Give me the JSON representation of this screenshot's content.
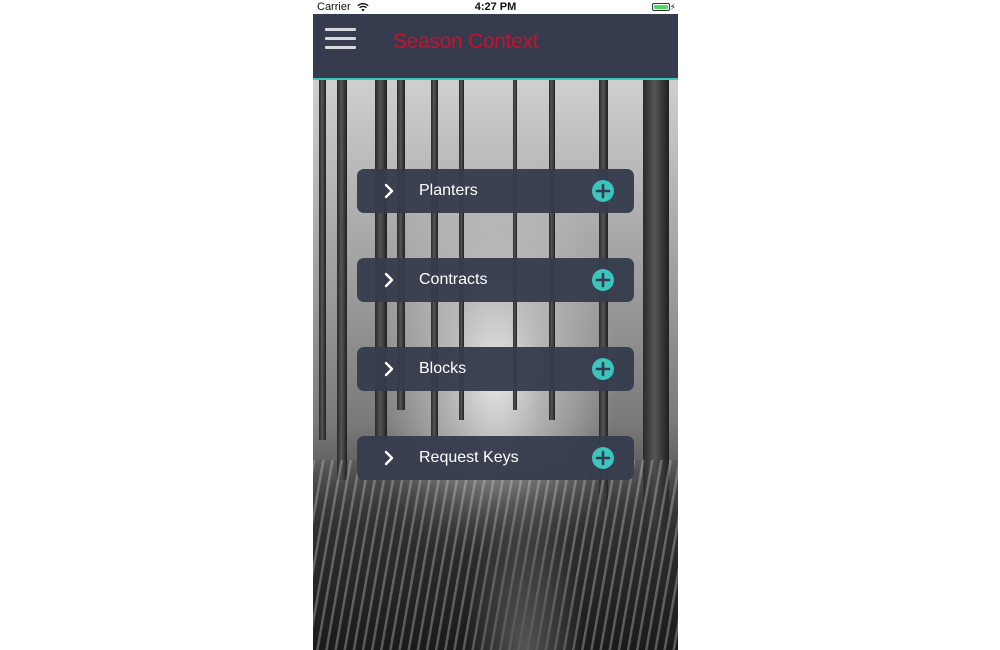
{
  "status_bar": {
    "carrier": "Carrier",
    "time": "4:27 PM",
    "wifi_icon": "wifi-icon",
    "battery_icon": "battery-icon"
  },
  "nav": {
    "title": "Season Context",
    "menu_icon": "hamburger-menu-icon",
    "title_color": "#c8102e",
    "background": "#363c4d",
    "accent": "#3cc4be"
  },
  "rows": [
    {
      "label": "Planters"
    },
    {
      "label": "Contracts"
    },
    {
      "label": "Blocks"
    },
    {
      "label": "Request Keys"
    }
  ]
}
